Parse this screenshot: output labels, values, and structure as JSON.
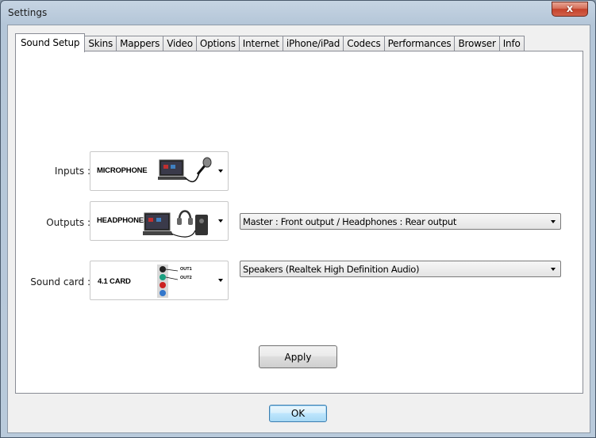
{
  "window": {
    "title": "Settings",
    "close_glyph": "x"
  },
  "tabs": [
    {
      "label": "Sound Setup",
      "active": true
    },
    {
      "label": "Skins"
    },
    {
      "label": "Mappers"
    },
    {
      "label": "Video"
    },
    {
      "label": "Options"
    },
    {
      "label": "Internet"
    },
    {
      "label": "iPhone/iPad"
    },
    {
      "label": "Codecs"
    },
    {
      "label": "Performances"
    },
    {
      "label": "Browser"
    },
    {
      "label": "Info"
    }
  ],
  "sound_setup": {
    "inputs": {
      "label": "Inputs :",
      "selected": "MICROPHONE",
      "icon": "microphone-laptop-icon"
    },
    "outputs": {
      "label": "Outputs :",
      "selected": "HEADPHONES",
      "icon": "headphones-laptop-icon",
      "routing": "Master : Front output / Headphones : Rear output"
    },
    "sound_card": {
      "label": "Sound card :",
      "selected": "4.1 CARD",
      "icon": "audio-jacks-icon",
      "jack_labels": [
        "OUT1",
        "OUT2"
      ],
      "device": "Speakers (Realtek High Definition Audio)"
    },
    "apply_label": "Apply"
  },
  "ok_label": "OK",
  "colors": {
    "default_button_border": "#3c7fb1",
    "close_button": "#c4422a"
  }
}
